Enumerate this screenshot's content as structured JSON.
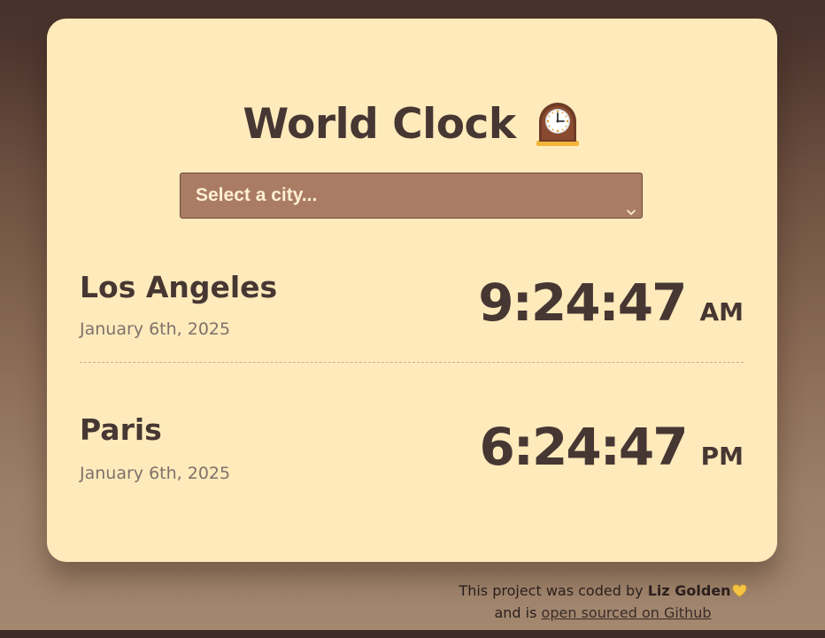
{
  "app": {
    "title": "World Clock",
    "title_icon": "mantelpiece-clock-icon"
  },
  "city_select": {
    "placeholder": "Select a city..."
  },
  "cities": [
    {
      "name": "Los Angeles",
      "date": "January 6th, 2025",
      "time": "9:24:47",
      "meridiem": "AM"
    },
    {
      "name": "Paris",
      "date": "January 6th, 2025",
      "time": "6:24:47",
      "meridiem": "PM"
    }
  ],
  "footer": {
    "text_prefix": "This project was coded by",
    "author": "Liz Golden",
    "heart_icon": "yellow-heart-icon",
    "text_middle": "and is",
    "link_text": "open sourced on Github"
  },
  "colors": {
    "card_background": "#ffeabb",
    "text_primary": "#463733",
    "select_background": "#aa7c64",
    "page_gradient_top": "#4a322c",
    "page_gradient_bottom": "#a3876f"
  }
}
